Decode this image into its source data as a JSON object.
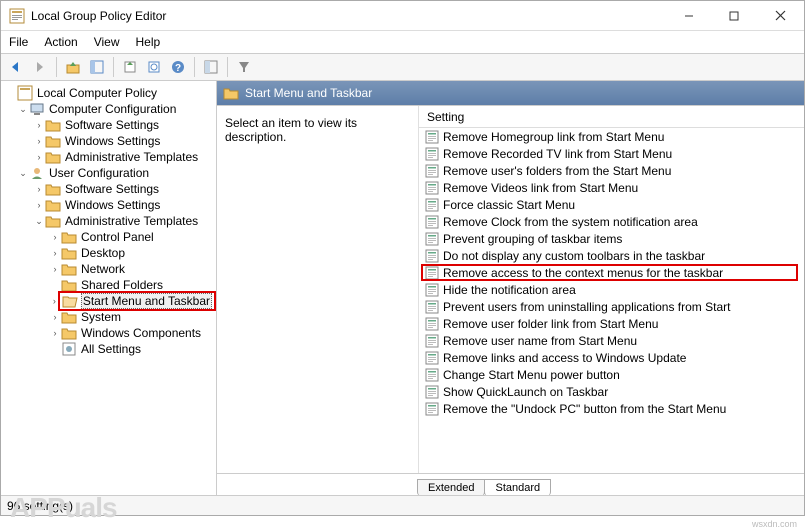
{
  "window": {
    "title": "Local Group Policy Editor"
  },
  "menu": {
    "file": "File",
    "action": "Action",
    "view": "View",
    "help": "Help"
  },
  "tree": {
    "root": "Local Computer Policy",
    "computer_config": "Computer Configuration",
    "cc_software": "Software Settings",
    "cc_windows": "Windows Settings",
    "cc_admin": "Administrative Templates",
    "user_config": "User Configuration",
    "uc_software": "Software Settings",
    "uc_windows": "Windows Settings",
    "uc_admin": "Administrative Templates",
    "control_panel": "Control Panel",
    "desktop": "Desktop",
    "network": "Network",
    "shared_folders": "Shared Folders",
    "start_menu": "Start Menu and Taskbar",
    "system": "System",
    "win_components": "Windows Components",
    "all_settings": "All Settings"
  },
  "header": {
    "title": "Start Menu and Taskbar"
  },
  "desc": {
    "text": "Select an item to view its description."
  },
  "list": {
    "header": "Setting",
    "items": [
      "Remove Homegroup link from Start Menu",
      "Remove Recorded TV link from Start Menu",
      "Remove user's folders from the Start Menu",
      "Remove Videos link from Start Menu",
      "Force classic Start Menu",
      "Remove Clock from the system notification area",
      "Prevent grouping of taskbar items",
      "Do not display any custom toolbars in the taskbar",
      "Remove access to the context menus for the taskbar",
      "Hide the notification area",
      "Prevent users from uninstalling applications from Start",
      "Remove user folder link from Start Menu",
      "Remove user name from Start Menu",
      "Remove links and access to Windows Update",
      "Change Start Menu power button",
      "Show QuickLaunch on Taskbar",
      "Remove the \"Undock PC\" button from the Start Menu"
    ],
    "highlighted_index": 8
  },
  "tabs": {
    "extended": "Extended",
    "standard": "Standard"
  },
  "status": {
    "text": "96 setting(s)"
  },
  "watermark": "wsxdn.com",
  "logo": "APPuals"
}
